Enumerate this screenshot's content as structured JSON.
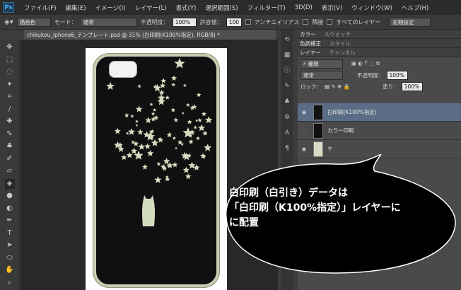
{
  "menu": {
    "logo": "Ps",
    "items": [
      "ファイル(F)",
      "編集(E)",
      "イメージ(I)",
      "レイヤー(L)",
      "書式(Y)",
      "選択範囲(S)",
      "フィルター(T)",
      "3D(D)",
      "表示(V)",
      "ウィンドウ(W)",
      "ヘルプ(H)"
    ]
  },
  "options": {
    "fill_source": "描画色",
    "mode_label": "モード：",
    "mode_value": "通常",
    "opacity_label": "不透明度：",
    "opacity_value": "100%",
    "tolerance_label": "許容値：",
    "tolerance_value": "100",
    "antialias_label": "アンチエイリアス",
    "contiguous_label": "隣接",
    "all_layers_label": "すべてのレイヤー",
    "preset": "初期設定"
  },
  "document": {
    "tab_title": "chikukou_iphone6_テンプレート.psd @ 31% (白印刷(K100%指定), RGB/8) *"
  },
  "panels": {
    "tabs_row1": [
      "カラー",
      "スウォッチ"
    ],
    "tabs_row2": [
      "色調補正",
      "スタイル"
    ],
    "tabs_row3": [
      "レイヤー",
      "チャンネル"
    ],
    "filter_kind": "種類",
    "blend_mode": "通常",
    "opacity_label": "不透明度：",
    "opacity_value": "100%",
    "lock_label": "ロック：",
    "fill_label": "塗り：",
    "fill_value": "100%",
    "layers": [
      {
        "name": "白印刷(K100%指定)",
        "selected": true
      },
      {
        "name": "カラー印刷",
        "selected": false
      },
      {
        "name": "ケ",
        "selected": false
      }
    ]
  },
  "callout": {
    "line1": "白印刷（白引き）データは",
    "line2": "「白印刷（K100%指定）」レイヤーに",
    "line3": "に配置"
  },
  "colors": {
    "phone_frame": "#c7cdb2",
    "star": "#d4dcc0",
    "selected_layer": "#5b6d86",
    "bubble": "#000000"
  }
}
